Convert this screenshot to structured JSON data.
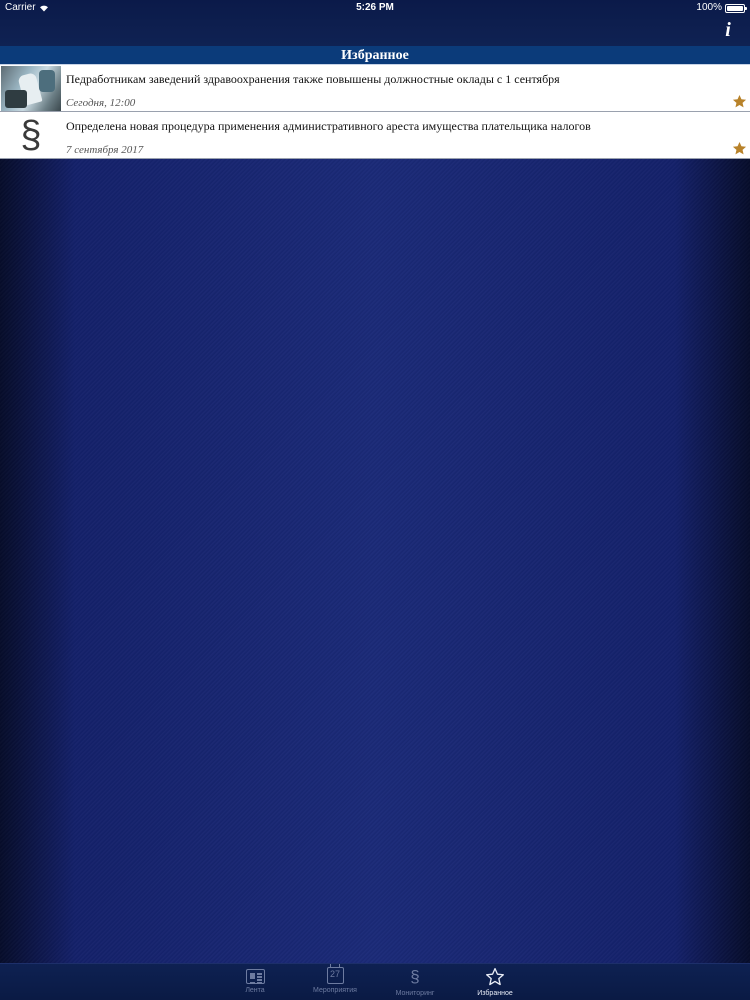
{
  "status_bar": {
    "carrier": "Carrier",
    "time": "5:26 PM",
    "battery": "100%"
  },
  "nav": {
    "info_label": "i"
  },
  "section": {
    "title": "Избранное"
  },
  "items": [
    {
      "title": "Педработникам заведений здравоохранения также повышены должностные оклады с 1 сентября",
      "date": "Сегодня, 12:00",
      "thumb": "photo",
      "favorite": true
    },
    {
      "title": "Определена новая процедура применения административного ареста имущества плательщика налогов",
      "date": "7 сентября 2017",
      "thumb": "paragraph-sign",
      "thumb_glyph": "§",
      "favorite": true
    }
  ],
  "tabs": [
    {
      "label": "Лента",
      "icon": "news-icon"
    },
    {
      "label": "Мероприятия",
      "icon": "calendar-icon",
      "icon_text": "27"
    },
    {
      "label": "Мониторинг",
      "icon": "paragraph-icon",
      "icon_text": "§"
    },
    {
      "label": "Избранное",
      "icon": "star-icon",
      "active": true
    }
  ],
  "colors": {
    "background": "#1b2a78",
    "header_bar": "#0b3b7a",
    "star": "#b8822a",
    "tab_active": "#e8ecf6",
    "tab_inactive": "#6d7ba0"
  }
}
